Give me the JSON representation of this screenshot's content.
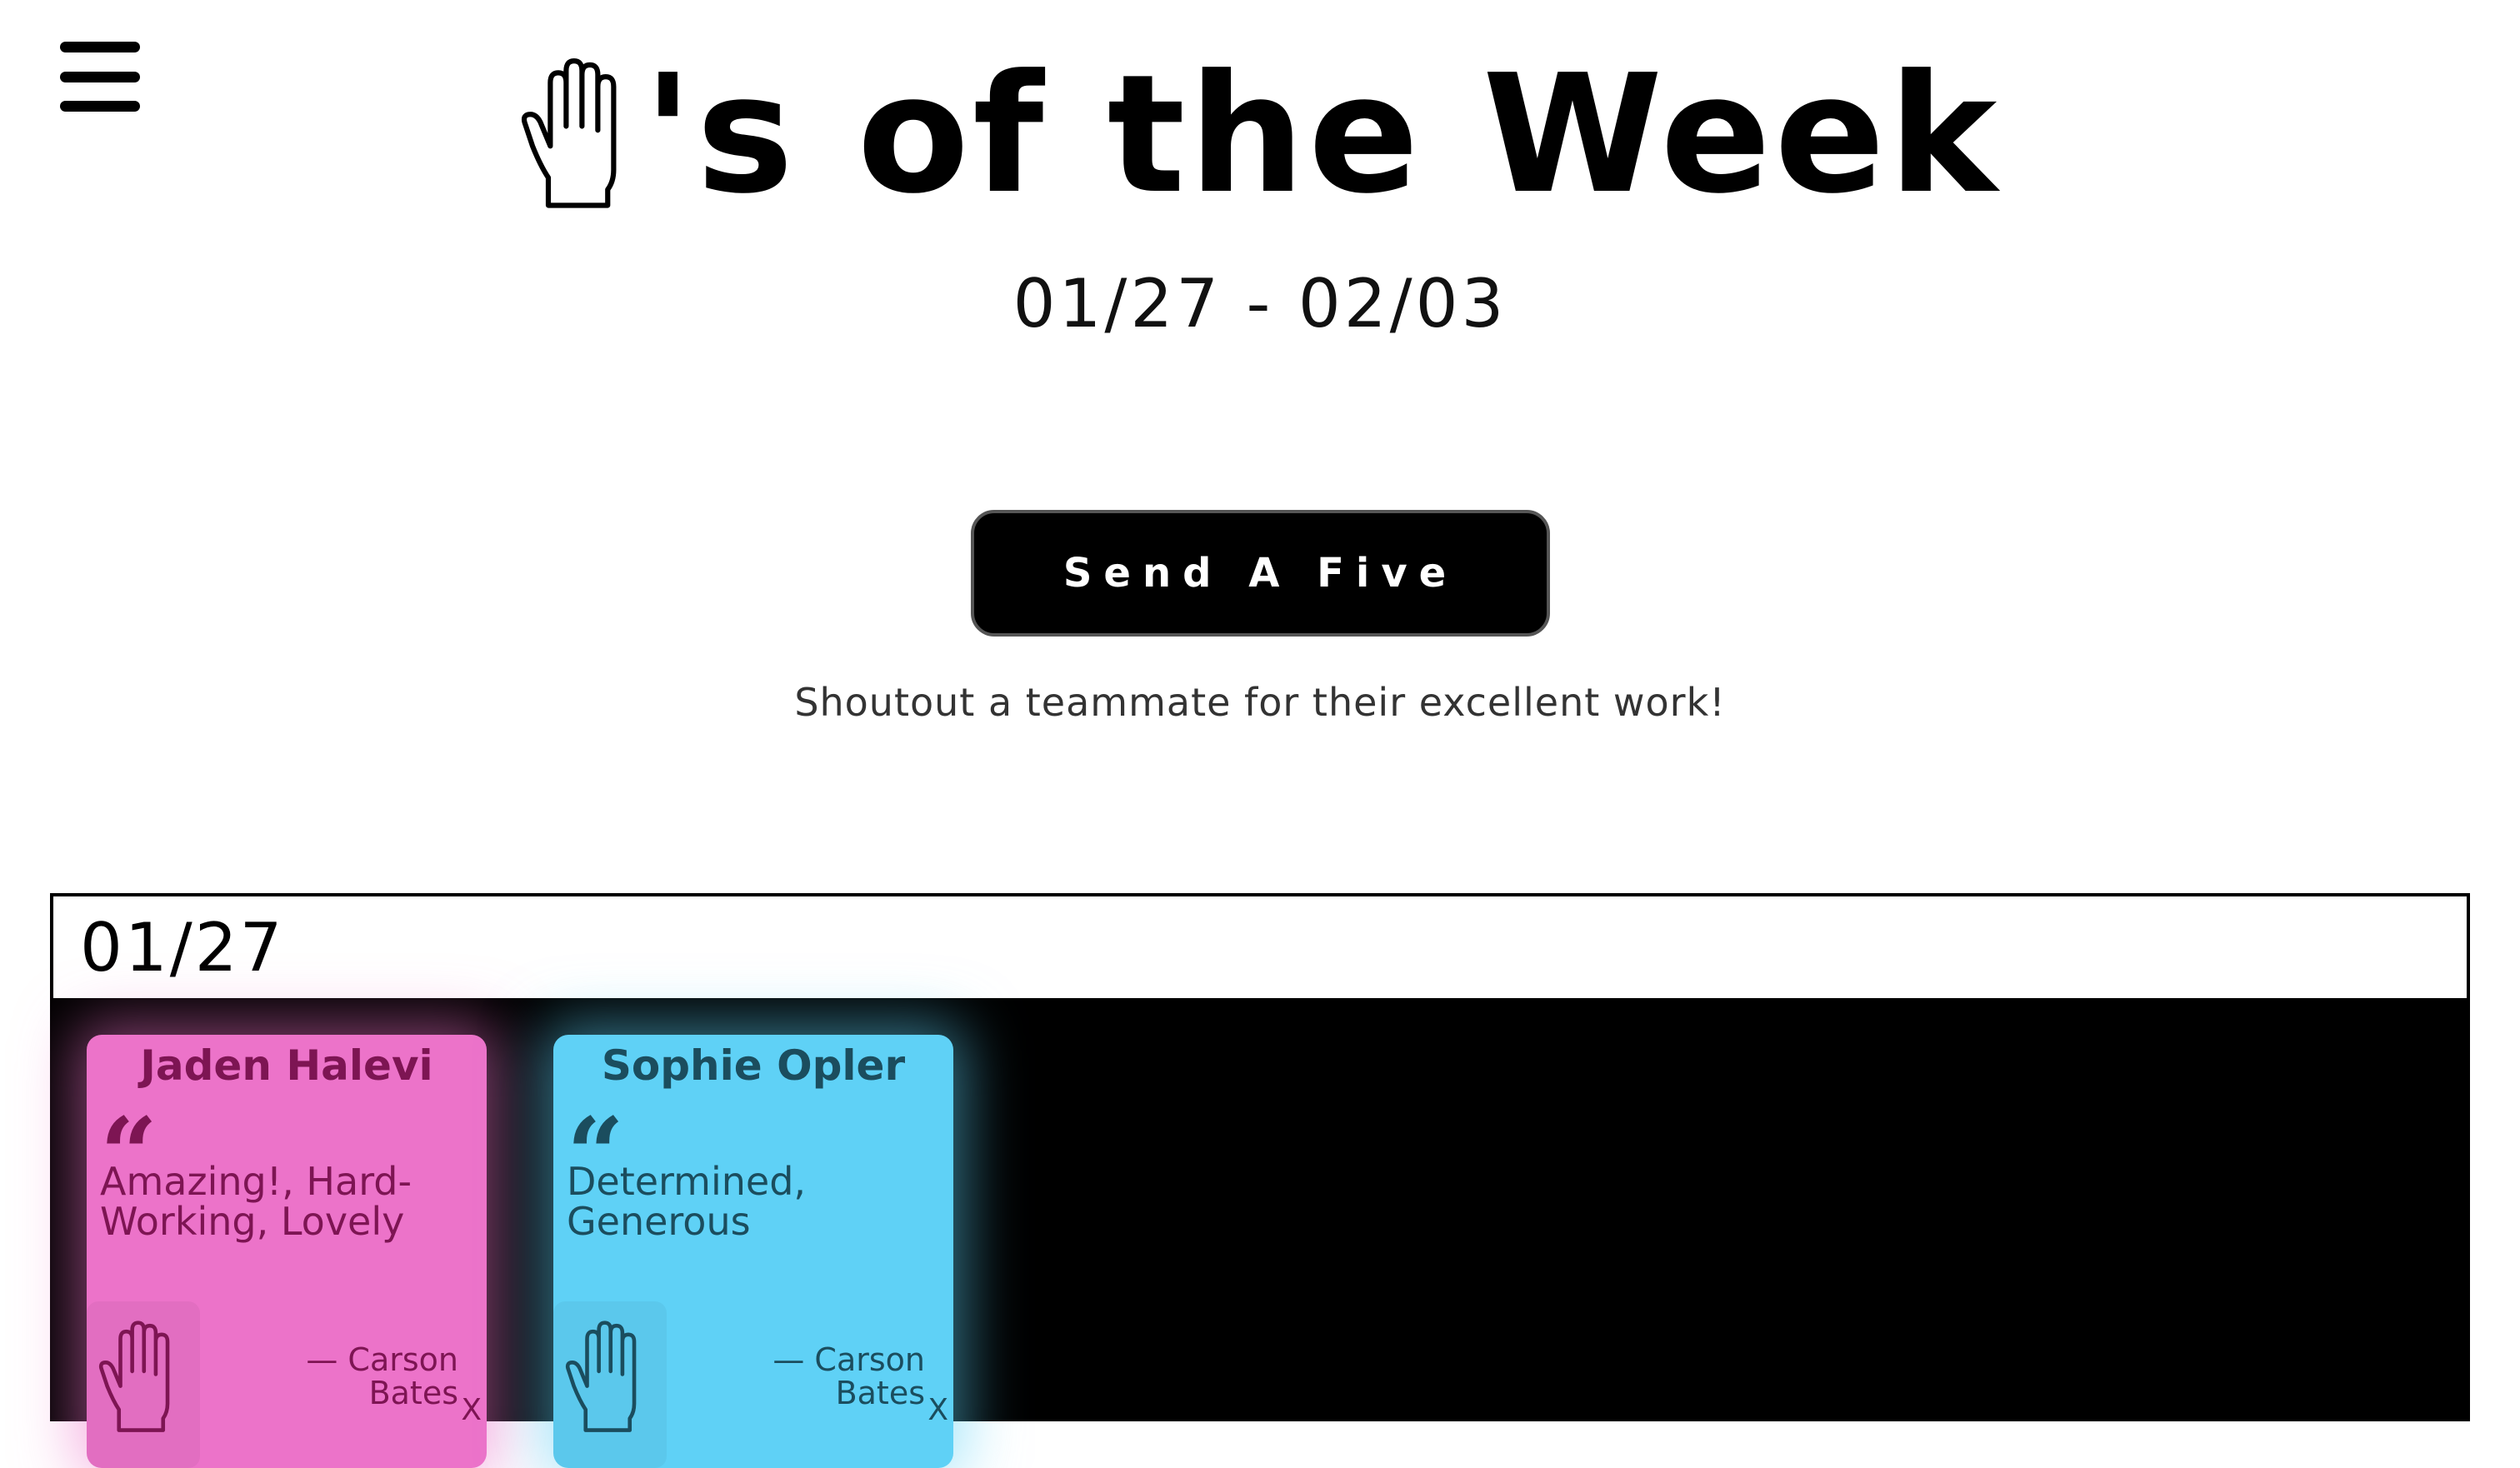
{
  "header": {
    "menu_icon": "hamburger-icon",
    "title_icon": "hand-icon",
    "title_text": "'s of the Week",
    "date_range": "01/27 - 02/03"
  },
  "cta": {
    "button_label": "Send A Five",
    "subtitle": "Shoutout a teammate for their excellent work!"
  },
  "week": {
    "label": "01/27",
    "cards": [
      {
        "name": "Jaden Halevi",
        "quote_mark": "“",
        "words": "Amazing!, Hard-Working, Lovely",
        "from": "— Carson Bates",
        "close": "X",
        "bg": "#ec73c9",
        "fg": "#7d1553"
      },
      {
        "name": "Sophie Opler",
        "quote_mark": "“",
        "words": "Determined, Generous",
        "from": "— Carson Bates",
        "close": "X",
        "bg": "#5fd1f6",
        "fg": "#1b4d5e"
      }
    ]
  }
}
